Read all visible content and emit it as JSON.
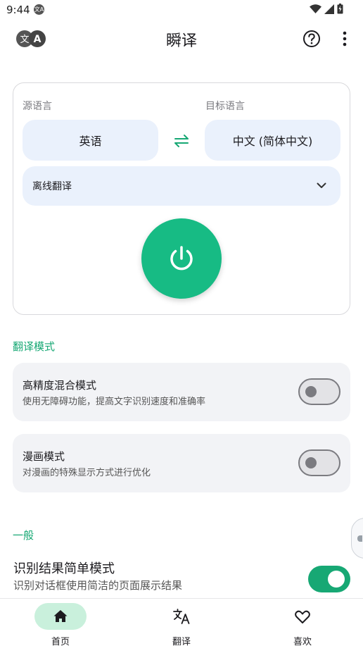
{
  "status_bar": {
    "time": "9:44"
  },
  "app_bar": {
    "title": "瞬译",
    "logo_icon": "translate-logo-icon",
    "help_icon": "help-circle-icon",
    "more_icon": "more-vert-icon"
  },
  "translate_card": {
    "source_label": "源语言",
    "target_label": "目标语言",
    "source_language": "英语",
    "target_language": "中文 (简体中文)",
    "swap_icon": "swap-arrows-icon",
    "mode_value": "离线翻译",
    "power_icon": "power-icon"
  },
  "translation_mode": {
    "header": "翻译模式",
    "items": [
      {
        "title": "高精度混合模式",
        "description": "使用无障碍功能，提高文字识别速度和准确率",
        "enabled": false
      },
      {
        "title": "漫画模式",
        "description": "对漫画的特殊显示方式进行优化",
        "enabled": false
      }
    ]
  },
  "general": {
    "header": "一般",
    "items": [
      {
        "title": "识别结果简单模式",
        "description": "识别对话框使用简洁的页面展示结果",
        "enabled": true
      }
    ]
  },
  "bottom_nav": {
    "items": [
      {
        "label": "首页",
        "icon": "home-icon",
        "selected": true
      },
      {
        "label": "翻译",
        "icon": "translate-icon",
        "selected": false
      },
      {
        "label": "喜欢",
        "icon": "heart-icon",
        "selected": false
      }
    ]
  },
  "colors": {
    "accent": "#17a874",
    "power_button": "#17bb84",
    "selection_bg": "#eaf1fc",
    "nav_pill": "#c9f0dc"
  }
}
